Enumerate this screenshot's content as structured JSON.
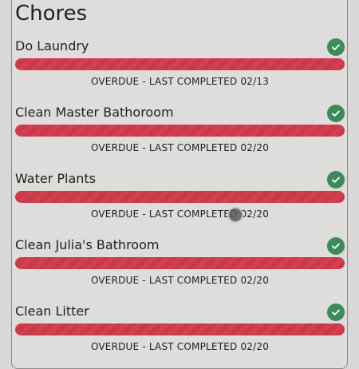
{
  "title": "Chores",
  "colors": {
    "overdue_bar": "#d33f4f",
    "check": "#3d8b5a",
    "background": "#d9d8d6"
  },
  "chores": [
    {
      "name": "Do Laundry",
      "status": "OVERDUE - LAST COMPLETED 02/13",
      "icon": "check-circle-icon"
    },
    {
      "name": "Clean Master Bathoroom",
      "status": "OVERDUE - LAST COMPLETED 02/20",
      "icon": "check-circle-icon"
    },
    {
      "name": "Water Plants",
      "status": "OVERDUE - LAST COMPLETED 02/20",
      "icon": "check-circle-icon"
    },
    {
      "name": "Clean Julia's Bathroom",
      "status": "OVERDUE - LAST COMPLETED 02/20",
      "icon": "check-circle-icon"
    },
    {
      "name": "Clean Litter",
      "status": "OVERDUE - LAST COMPLETED 02/20",
      "icon": "check-circle-icon"
    }
  ]
}
